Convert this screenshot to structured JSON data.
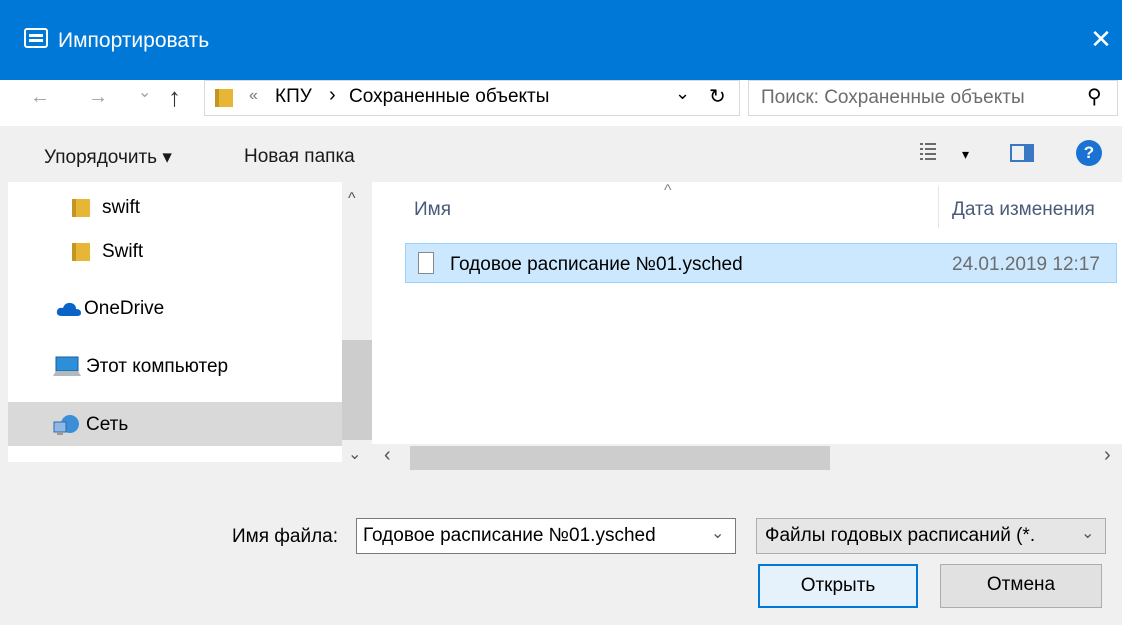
{
  "window": {
    "title": "Импортировать",
    "close_glyph": "✕"
  },
  "nav": {
    "back": "←",
    "forward": "→",
    "recent": "⌄",
    "up": "↑",
    "breadcrumb": {
      "overflow": "«",
      "items": [
        "КПУ",
        "Сохраненные объекты"
      ],
      "separator": "›"
    },
    "dropdown": "⌄",
    "refresh": "↻",
    "search_placeholder": "Поиск: Сохраненные объекты",
    "search_icon": "⚲"
  },
  "toolbar": {
    "organize": "Упорядочить ▾",
    "new_folder": "Новая папка",
    "view_dropdown": "▾",
    "help": "?"
  },
  "sidebar": {
    "items": [
      {
        "label": "swift",
        "icon": "folder-icon"
      },
      {
        "label": "Swift",
        "icon": "folder-icon"
      },
      {
        "label": "OneDrive",
        "icon": "onedrive-icon"
      },
      {
        "label": "Этот компьютер",
        "icon": "computer-icon"
      },
      {
        "label": "Сеть",
        "icon": "network-icon",
        "selected": true
      }
    ],
    "scroll_up": "^",
    "scroll_down": "⌄"
  },
  "files": {
    "columns": {
      "name": "Имя",
      "date": "Дата изменения",
      "sort_glyph": "^"
    },
    "rows": [
      {
        "name": "Годовое расписание №01.ysched",
        "date": "24.01.2019 12:17"
      }
    ],
    "scroll_left": "‹",
    "scroll_right": "›"
  },
  "footer": {
    "filename_label": "Имя файла:",
    "filename_value": "Годовое расписание №01.ysched",
    "filetype_value": "Файлы годовых расписаний (*.",
    "dropdown": "⌄",
    "open": "Открыть",
    "cancel": "Отмена"
  },
  "colors": {
    "titlebar": "#0078d7",
    "selection": "#cce8ff",
    "accent": "#0078d7"
  }
}
